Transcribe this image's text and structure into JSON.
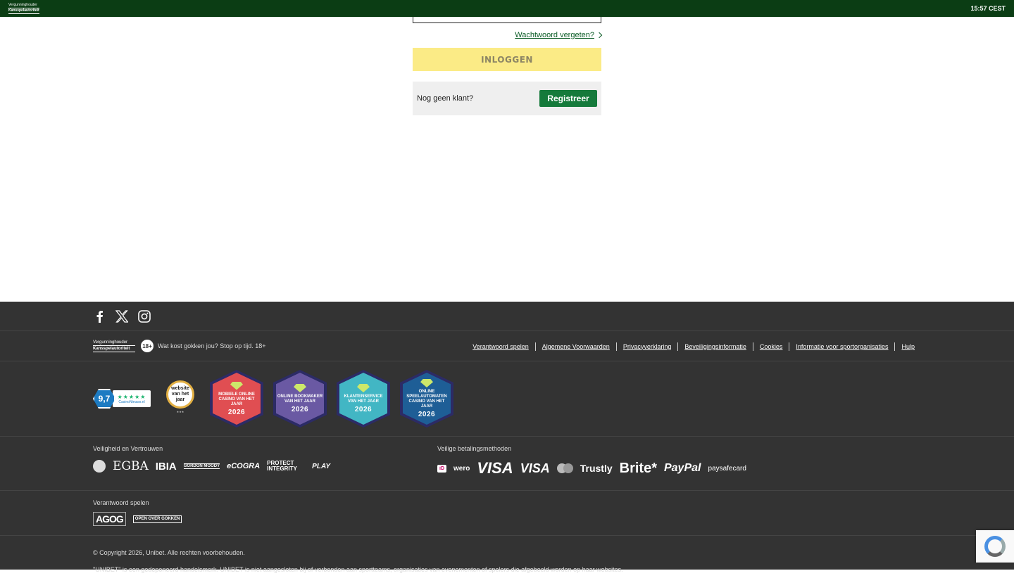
{
  "topbar": {
    "regulator_line1": "Vergunninghouder",
    "regulator_line2": "Kansspelautoriteit",
    "time": "15:57 CEST"
  },
  "login": {
    "forgot_label": "Wachtwoord vergeten?",
    "submit_label": "INLOGGEN",
    "no_account_label": "Nog geen klant?",
    "register_label": "Registreer"
  },
  "footer": {
    "social": [
      "facebook-icon",
      "x-icon",
      "instagram-icon"
    ],
    "regulator_line1": "Vergunninghouder",
    "regulator_line2": "Kansspelautoriteit",
    "age_badge": "18+",
    "warning": "Wat kost gokken jou? Stop op tijd. 18+",
    "links": [
      "Verantwoord spelen",
      "Algemene Voorwaarden",
      "Privacyverklaring",
      "Beveiligingsinformatie",
      "Cookies",
      "Informatie voor sportorganisaties",
      "Hulp"
    ],
    "rating": {
      "score": "9,7",
      "stars": "★★★★★",
      "site": "CasinoNieuws.nl"
    },
    "website_award": "website van het jaar",
    "awards": [
      {
        "title": "MOBIELE ONLINE CASINO VAN HET JAAR",
        "year": "2026",
        "color": "#e04e52",
        "ring": "#2c2b66"
      },
      {
        "title": "ONLINE BOOKMAKER VAN HET JAAR",
        "year": "2026",
        "color": "#6a59a3",
        "ring": "#2c2b66"
      },
      {
        "title": "KLANTENSERVICE VAN HET JAAR",
        "year": "2026",
        "color": "#42b6c4",
        "ring": "#2c2b66"
      },
      {
        "title": "ONLINE SPEELAUTOMATEN CASINO VAN HET JAAR",
        "year": "2026",
        "color": "#1e5e96",
        "ring": "#2c2b66"
      }
    ],
    "trust_title": "Veiligheid en Vertrouwen",
    "trust_logos": [
      "EGBA",
      "IBIA",
      "GORDON MOODY",
      "eCOGRA",
      "PROTECT INTEGRITY",
      "PLAY"
    ],
    "pay_title": "Veilige betalingsmethoden",
    "pay_logos": [
      "wero",
      "VISA",
      "VISA",
      "Trustly",
      "Brite*",
      "PayPal",
      "paysafecard"
    ],
    "responsible_title": "Verantwoord spelen",
    "responsible_logos": [
      "AGOG",
      "OPEN OVER GOKKEN"
    ],
    "copyright": "© Copyright 2026, Unibet. Alle rechten voorbehouden.",
    "trademark": "\"UNIBET\" is een gedeponeerd handelsmerk. UNIBET is niet aangesloten bij of verbonden aan sportteams, organisaties van evenementen of spelers die afgebeeld worden op haar websites."
  }
}
